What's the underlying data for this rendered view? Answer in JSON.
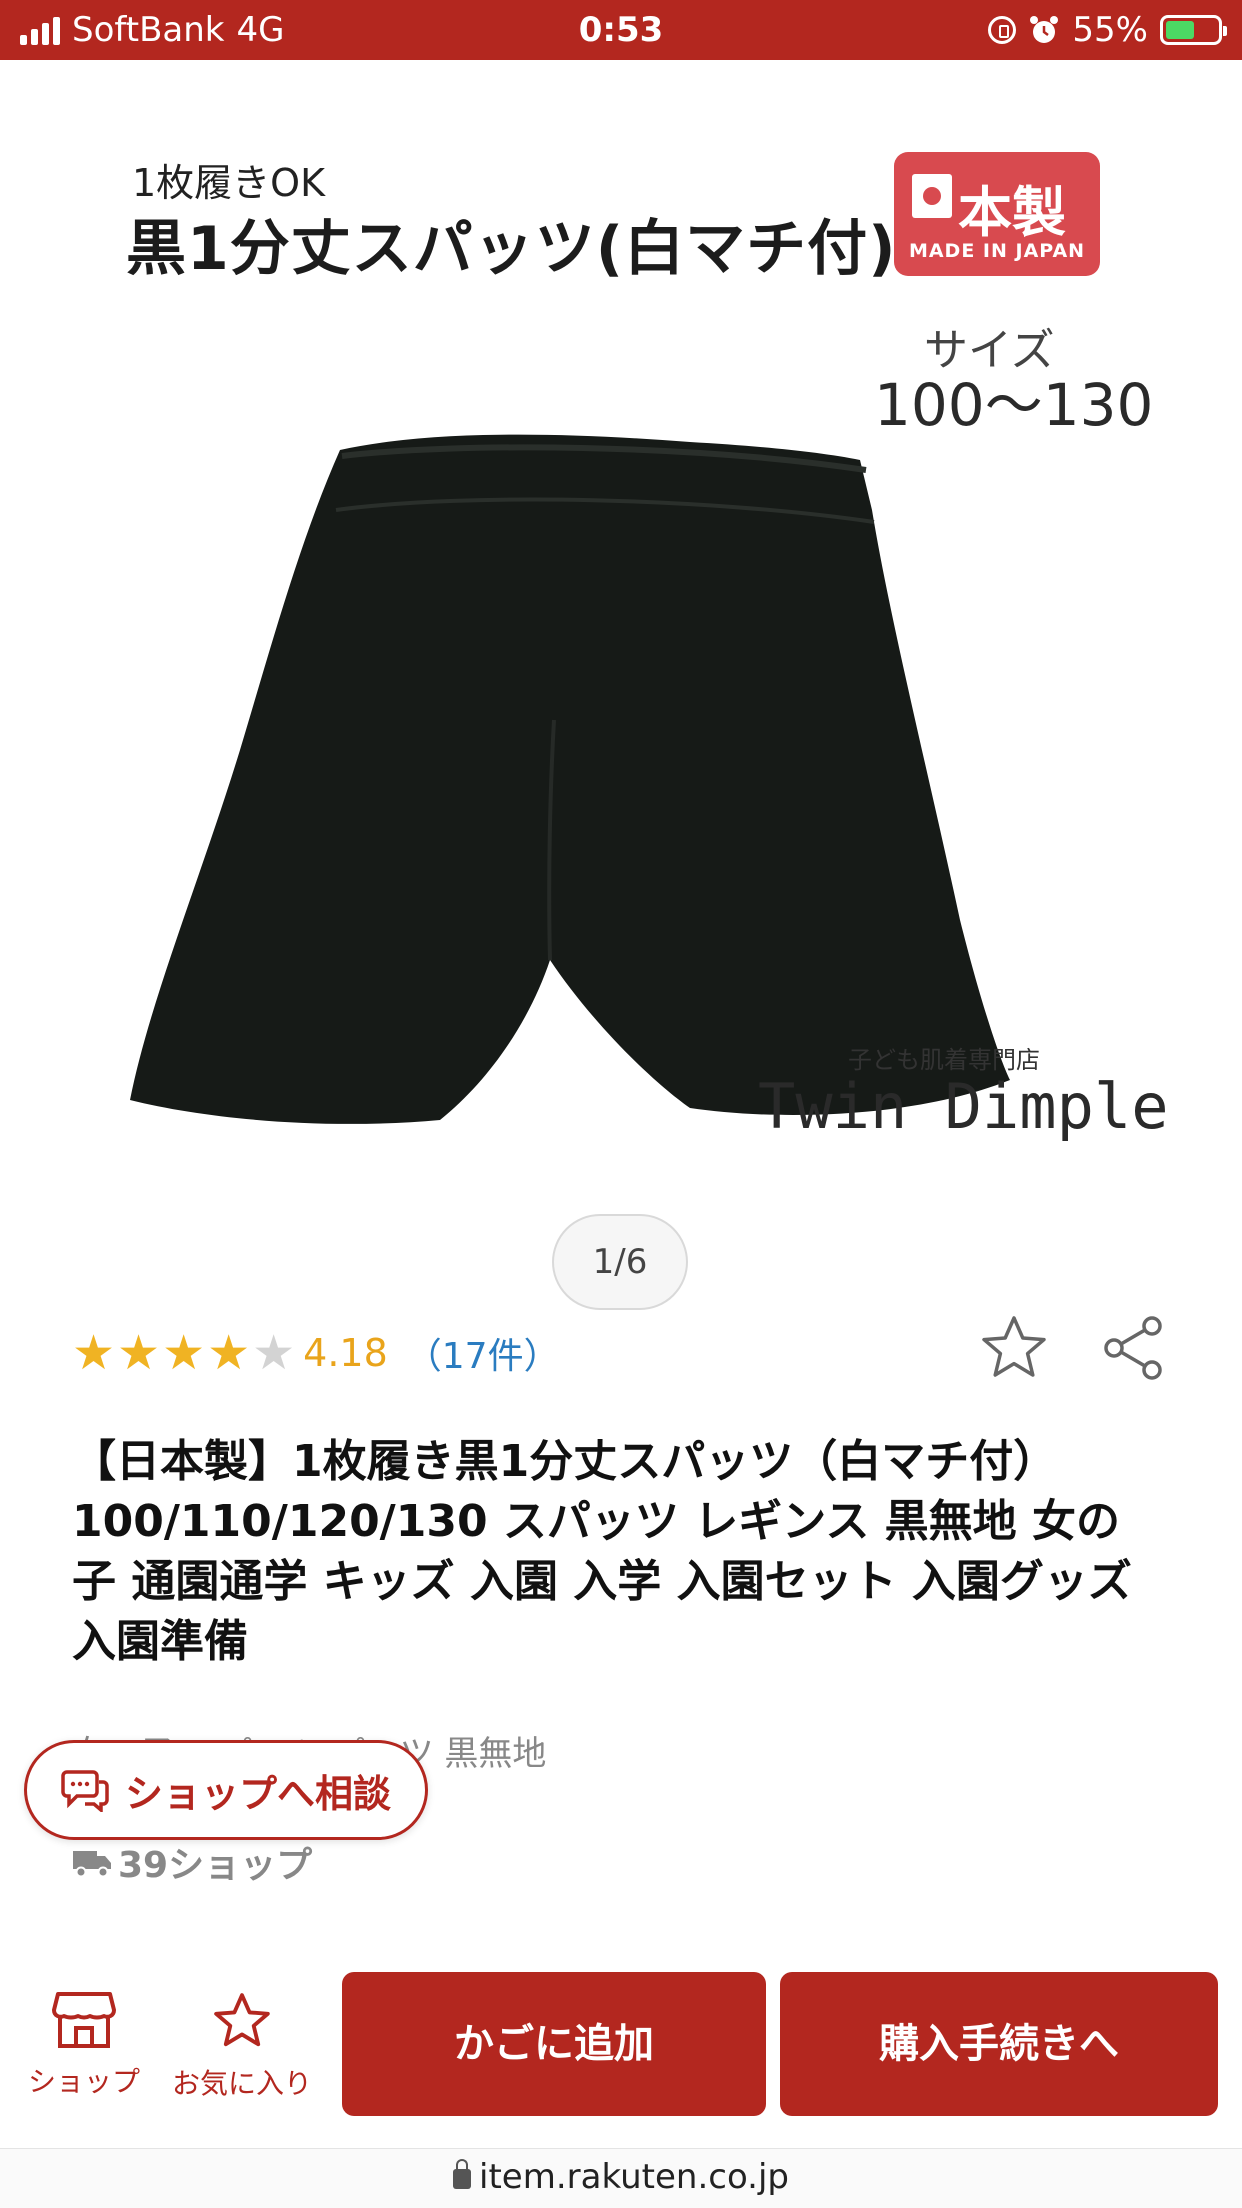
{
  "status_bar": {
    "carrier": "SoftBank",
    "network": "4G",
    "time": "0:53",
    "battery": "55%",
    "battery_level": 0.55
  },
  "product_image": {
    "subtitle": "1枚履きOK",
    "title": "黒1分丈スパッツ(白マチ付)",
    "badge_main": "本製",
    "badge_en": "MADE IN JAPAN",
    "size_label": "サイズ",
    "size_range": "100～130",
    "shop_subtitle": "子ども肌着専門店",
    "shop_logo": "Twin Dimple",
    "counter": "1/6"
  },
  "rating": {
    "score": 4.18,
    "score_text": "4.18",
    "count_text": "（17件）",
    "stars": [
      "★",
      "★",
      "★",
      "★",
      "★"
    ]
  },
  "product": {
    "title": "【日本製】1枚履き黒1分丈スパッツ（白マチ付）100/110/120/130 スパッツ レギンス 黒無地 女の子 通園通学 キッズ 入園 入学 入園セット 入園グッズ 入園準備",
    "tags": "女の子 スパッツ パッツ 黒無地",
    "shipping_text": "39ショップ"
  },
  "consult_button": {
    "label": "ショップへ相談"
  },
  "action_bar": {
    "shop_label": "ショップ",
    "fav_label": "お気に入り",
    "cart_label": "かごに追加",
    "buy_label": "購入手続きへ"
  },
  "url_bar": {
    "url": "item.rakuten.co.jp"
  },
  "colors": {
    "brand": "#b3271f",
    "star": "#f0b323",
    "link": "#2a7cc0"
  }
}
